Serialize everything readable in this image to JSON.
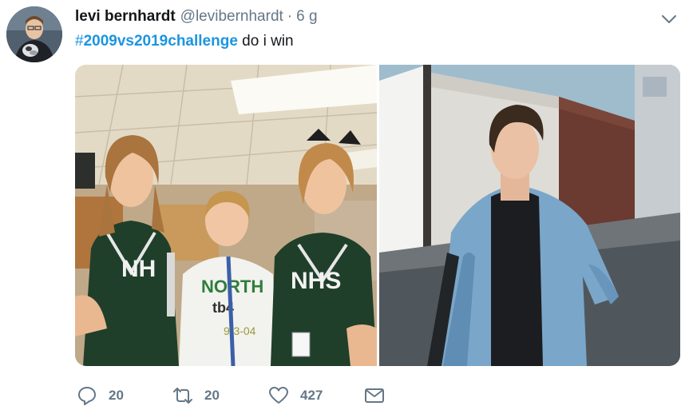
{
  "tweet": {
    "author": {
      "display_name": "levi bernhardt",
      "handle": "@levibernhardt",
      "avatar_icon": "profile-photo"
    },
    "separator": "·",
    "timestamp": "6 g",
    "text": {
      "hashtag_symbol": "#",
      "hashtag": "2009vs2019challenge",
      "body": " do i win"
    },
    "media": [
      {
        "name": "photo-2009",
        "description_icon": "image"
      },
      {
        "name": "photo-2019",
        "description_icon": "image"
      }
    ],
    "actions": {
      "reply_count": "20",
      "retweet_count": "20",
      "like_count": "427"
    },
    "colors": {
      "link": "#1b95e0",
      "secondary_text": "#657786",
      "primary_text": "#14171a"
    }
  }
}
